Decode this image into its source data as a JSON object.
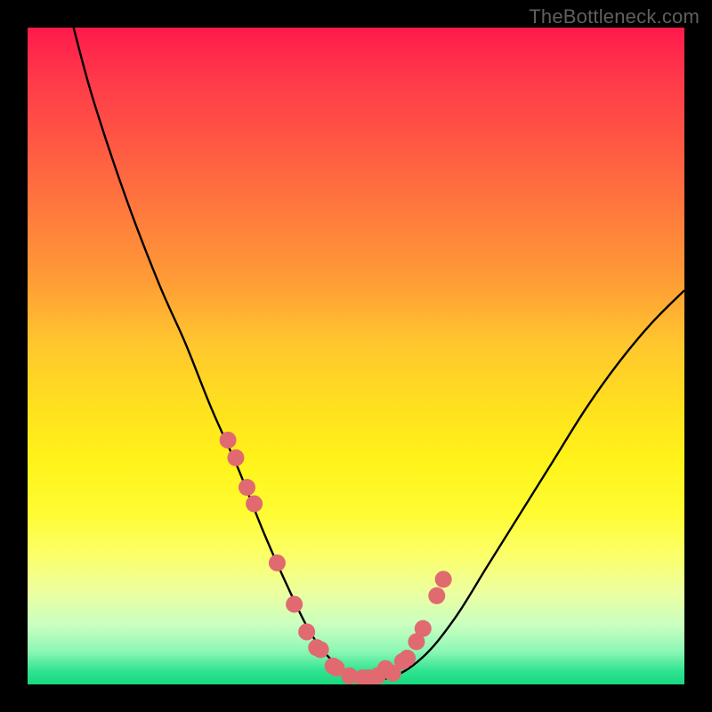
{
  "watermark": "TheBottleneck.com",
  "colors": {
    "frame": "#000000",
    "curve_stroke": "#000000",
    "marker_fill": "#e06a70",
    "bottom_band": "#18d97f"
  },
  "chart_data": {
    "type": "line",
    "title": "",
    "xlabel": "",
    "ylabel": "",
    "xlim": [
      0,
      100
    ],
    "ylim": [
      0,
      100
    ],
    "series": [
      {
        "name": "bottleneck-curve",
        "x": [
          7,
          10,
          15,
          20,
          24,
          28,
          32,
          36,
          40,
          43,
          46,
          50,
          55,
          60,
          65,
          70,
          75,
          80,
          85,
          90,
          95,
          100
        ],
        "y": [
          100,
          89,
          74,
          61,
          52,
          42,
          33,
          23,
          14,
          8,
          4,
          1,
          1,
          4,
          10,
          18,
          26,
          34,
          42,
          49,
          55,
          60
        ]
      }
    ],
    "markers": {
      "name": "highlighted-points",
      "x": [
        30.5,
        31.7,
        33.4,
        34.5,
        38.0,
        40.6,
        42.5,
        44.0,
        44.6,
        46.5,
        47.0,
        49.0,
        51.0,
        52.0,
        53.3,
        54.5,
        55.6,
        57.1,
        57.8,
        59.2,
        60.2,
        62.3,
        63.3
      ],
      "y": [
        37.2,
        34.5,
        30.0,
        27.5,
        18.5,
        12.2,
        8.0,
        5.6,
        5.3,
        2.8,
        2.5,
        1.3,
        1.0,
        1.0,
        1.3,
        2.4,
        1.7,
        3.5,
        4.0,
        6.5,
        8.5,
        13.5,
        16.0
      ]
    }
  }
}
